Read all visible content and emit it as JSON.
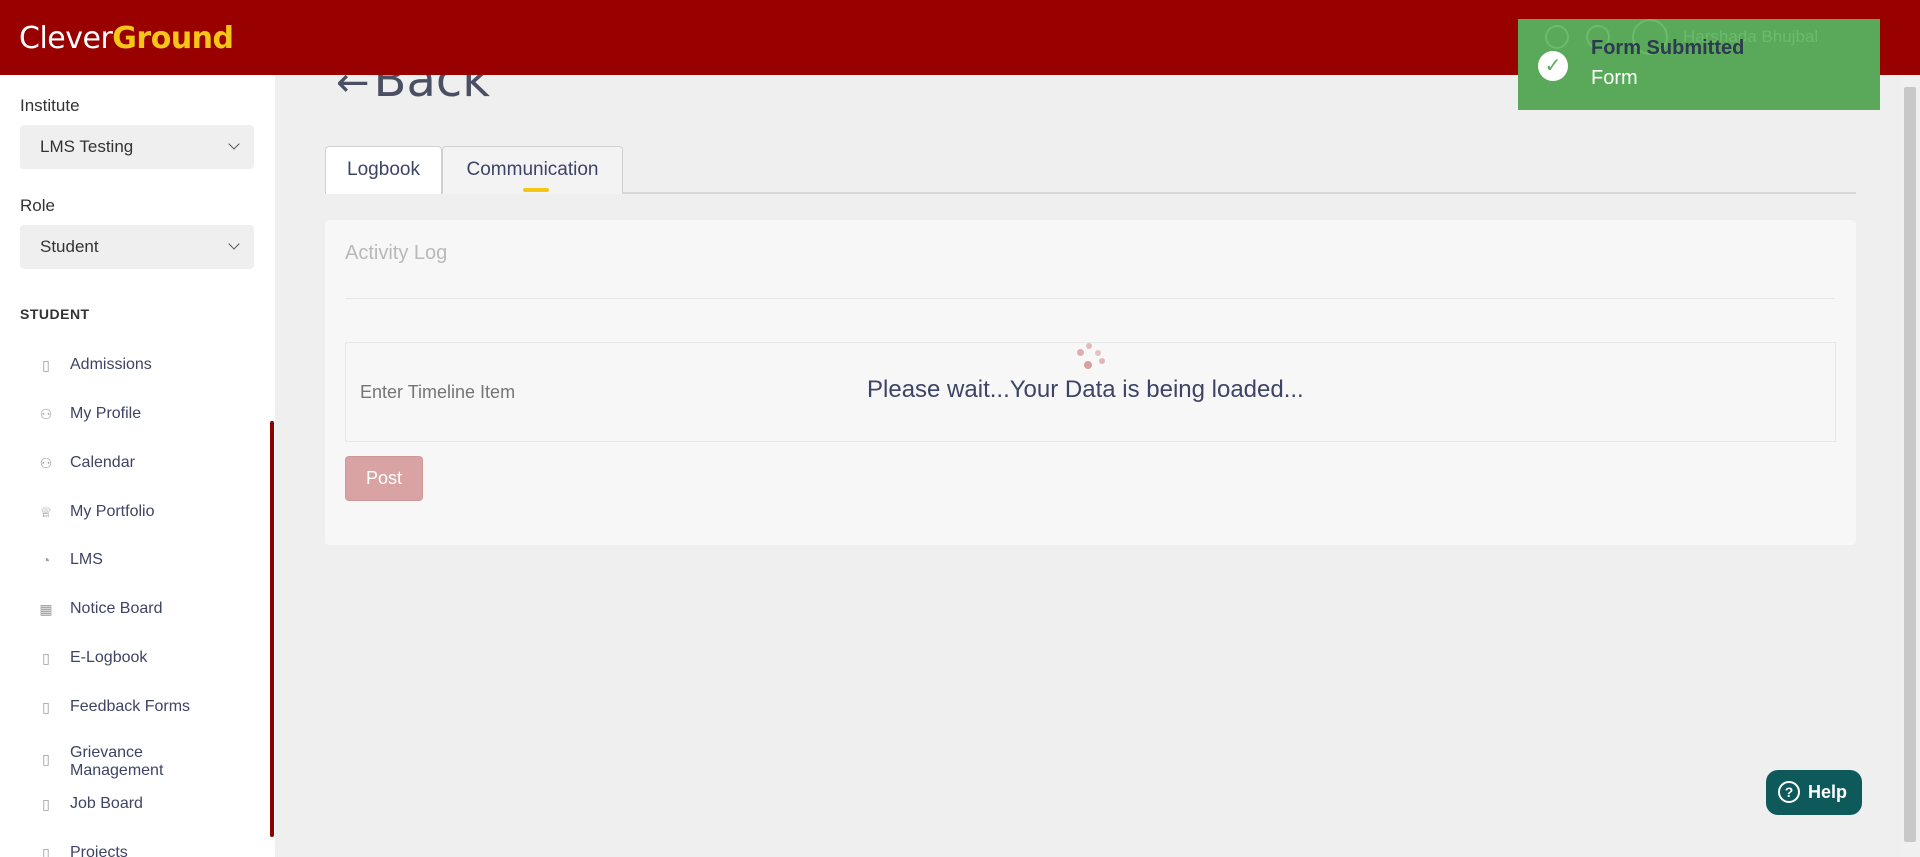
{
  "header": {
    "logo_part1": "Clever",
    "logo_part2": "Ground",
    "user_name": "Harshada Bhujbal"
  },
  "sidebar": {
    "institute_label": "Institute",
    "institute_value": "LMS Testing",
    "role_label": "Role",
    "role_value": "Student",
    "section_title": "STUDENT",
    "items": [
      {
        "label": "Admissions",
        "icon": "book-icon"
      },
      {
        "label": "My Profile",
        "icon": "user-icon"
      },
      {
        "label": "Calendar",
        "icon": "user-icon"
      },
      {
        "label": "My Portfolio",
        "icon": "trophy-icon"
      },
      {
        "label": "LMS",
        "icon": "gauge-icon"
      },
      {
        "label": "Notice Board",
        "icon": "calendar-icon"
      },
      {
        "label": "E-Logbook",
        "icon": "book-icon"
      },
      {
        "label": "Feedback Forms",
        "icon": "book-icon"
      },
      {
        "label": "Grievance Management",
        "icon": "book-icon"
      },
      {
        "label": "Job Board",
        "icon": "book-icon"
      },
      {
        "label": "Projects",
        "icon": "book-icon"
      }
    ]
  },
  "main": {
    "back_label": "Back",
    "tabs": [
      {
        "label": "Logbook"
      },
      {
        "label": "Communication"
      }
    ],
    "card_title": "Activity Log",
    "timeline_placeholder": "Enter Timeline Item",
    "post_label": "Post",
    "loading_text": "Please wait...Your Data is being loaded..."
  },
  "toast": {
    "title": "Form Submitted",
    "message": "Form"
  },
  "help_label": "Help",
  "colors": {
    "brand_red": "#990000",
    "brand_yellow": "#f5c518",
    "toast_green": "#5aa95a",
    "help_teal": "#0e5a5a"
  }
}
